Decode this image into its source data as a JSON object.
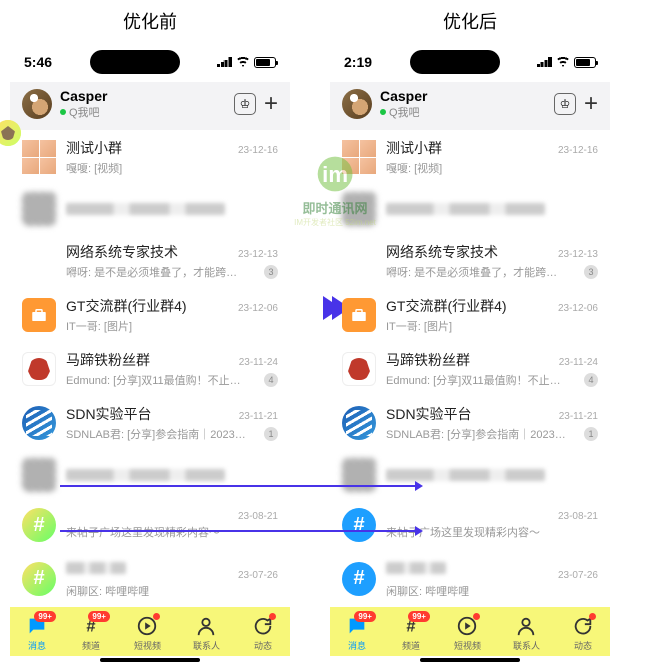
{
  "labels": {
    "before": "优化前",
    "after": "优化后"
  },
  "watermark": {
    "main": "即时通讯网",
    "sub": "IM开发者社区 52im.net"
  },
  "status": {
    "time_before": "5:46",
    "time_after": "2:19"
  },
  "header": {
    "name": "Casper",
    "status": "Q我吧",
    "crown_icon": "crown"
  },
  "conversations": [
    {
      "avatar": "grid",
      "title": "测试小群",
      "time": "23-12-16",
      "msg": "嘎嗄: [视频]",
      "badge": ""
    },
    {
      "avatar": "redacted",
      "title": "",
      "time": "",
      "msg": "",
      "badge": "",
      "redacted": true
    },
    {
      "avatar": "none",
      "title": "网络系统专家技术",
      "time": "23-12-13",
      "msg": "嘚呀: 是不是必须堆叠了，才能跨交换机…",
      "badge": "3",
      "indent": true
    },
    {
      "avatar": "briefcase",
      "title": "GT交流群(行业群4)",
      "time": "23-12-06",
      "msg": "IT一哥: [图片]",
      "badge": ""
    },
    {
      "avatar": "horse",
      "title": "马蹄铁粉丝群",
      "time": "23-11-24",
      "msg": "Edmund: [分享]双11最值购！不止实现喝…",
      "badge": "4"
    },
    {
      "avatar": "sdn",
      "title": "SDN实验平台",
      "time": "23-11-21",
      "msg": "SDNLAB君: [分享]参会指南｜2023第六届…",
      "badge": "1"
    },
    {
      "avatar": "redacted",
      "title": "",
      "time": "",
      "msg": "",
      "badge": "",
      "redacted": true
    },
    {
      "avatar": "hash",
      "title": "",
      "time": "23-08-21",
      "msg": "来帖子广场这里发现精彩内容～",
      "badge": ""
    },
    {
      "avatar": "hash",
      "title": "",
      "time": "23-07-26",
      "msg": "闲聊区: 哔哩哔哩",
      "badge": "",
      "title_redacted": true
    }
  ],
  "tabs": [
    {
      "label": "消息",
      "icon": "chat",
      "badge": "99+",
      "active": true
    },
    {
      "label": "频道",
      "icon": "hash",
      "badge": "99+"
    },
    {
      "label": "短视频",
      "icon": "play",
      "dot": true
    },
    {
      "label": "联系人",
      "icon": "person"
    },
    {
      "label": "动态",
      "icon": "refresh",
      "dot": true
    }
  ]
}
